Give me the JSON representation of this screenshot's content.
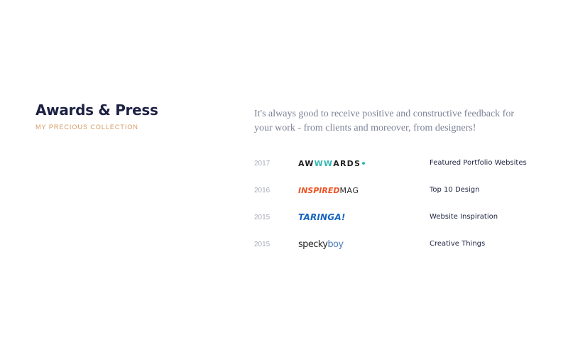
{
  "section": {
    "title": "Awards & Press",
    "subtitle": "MY PRECIOUS COLLECTION",
    "intro": "It's always good to receive positive and constructive feedback for your work - from clients and moreover, from designers!"
  },
  "awards": [
    {
      "year": "2017",
      "logo": {
        "name": "awwwards",
        "parts": [
          "AW",
          "WW",
          "ARDS"
        ]
      },
      "category": "Featured Portfolio Websites"
    },
    {
      "year": "2016",
      "logo": {
        "name": "inspiredmag",
        "parts": [
          "INSPIRED",
          "MAG"
        ]
      },
      "category": "Top 10 Design"
    },
    {
      "year": "2015",
      "logo": {
        "name": "taringa",
        "parts": [
          "TARINGA!"
        ]
      },
      "category": "Website Inspiration"
    },
    {
      "year": "2015",
      "logo": {
        "name": "speckyboy",
        "parts": [
          "specky",
          "boy"
        ]
      },
      "category": "Creative Things"
    }
  ],
  "colors": {
    "heading": "#1c2143",
    "subtitle_accent": "#d39a63",
    "body_text": "#7d8197",
    "year_text": "#a7aabb",
    "awwwards_accent": "#33b7b0",
    "inspired_accent": "#ea5427",
    "taringa_blue": "#1764c0",
    "speckyboy_blue": "#4a7fb8"
  }
}
